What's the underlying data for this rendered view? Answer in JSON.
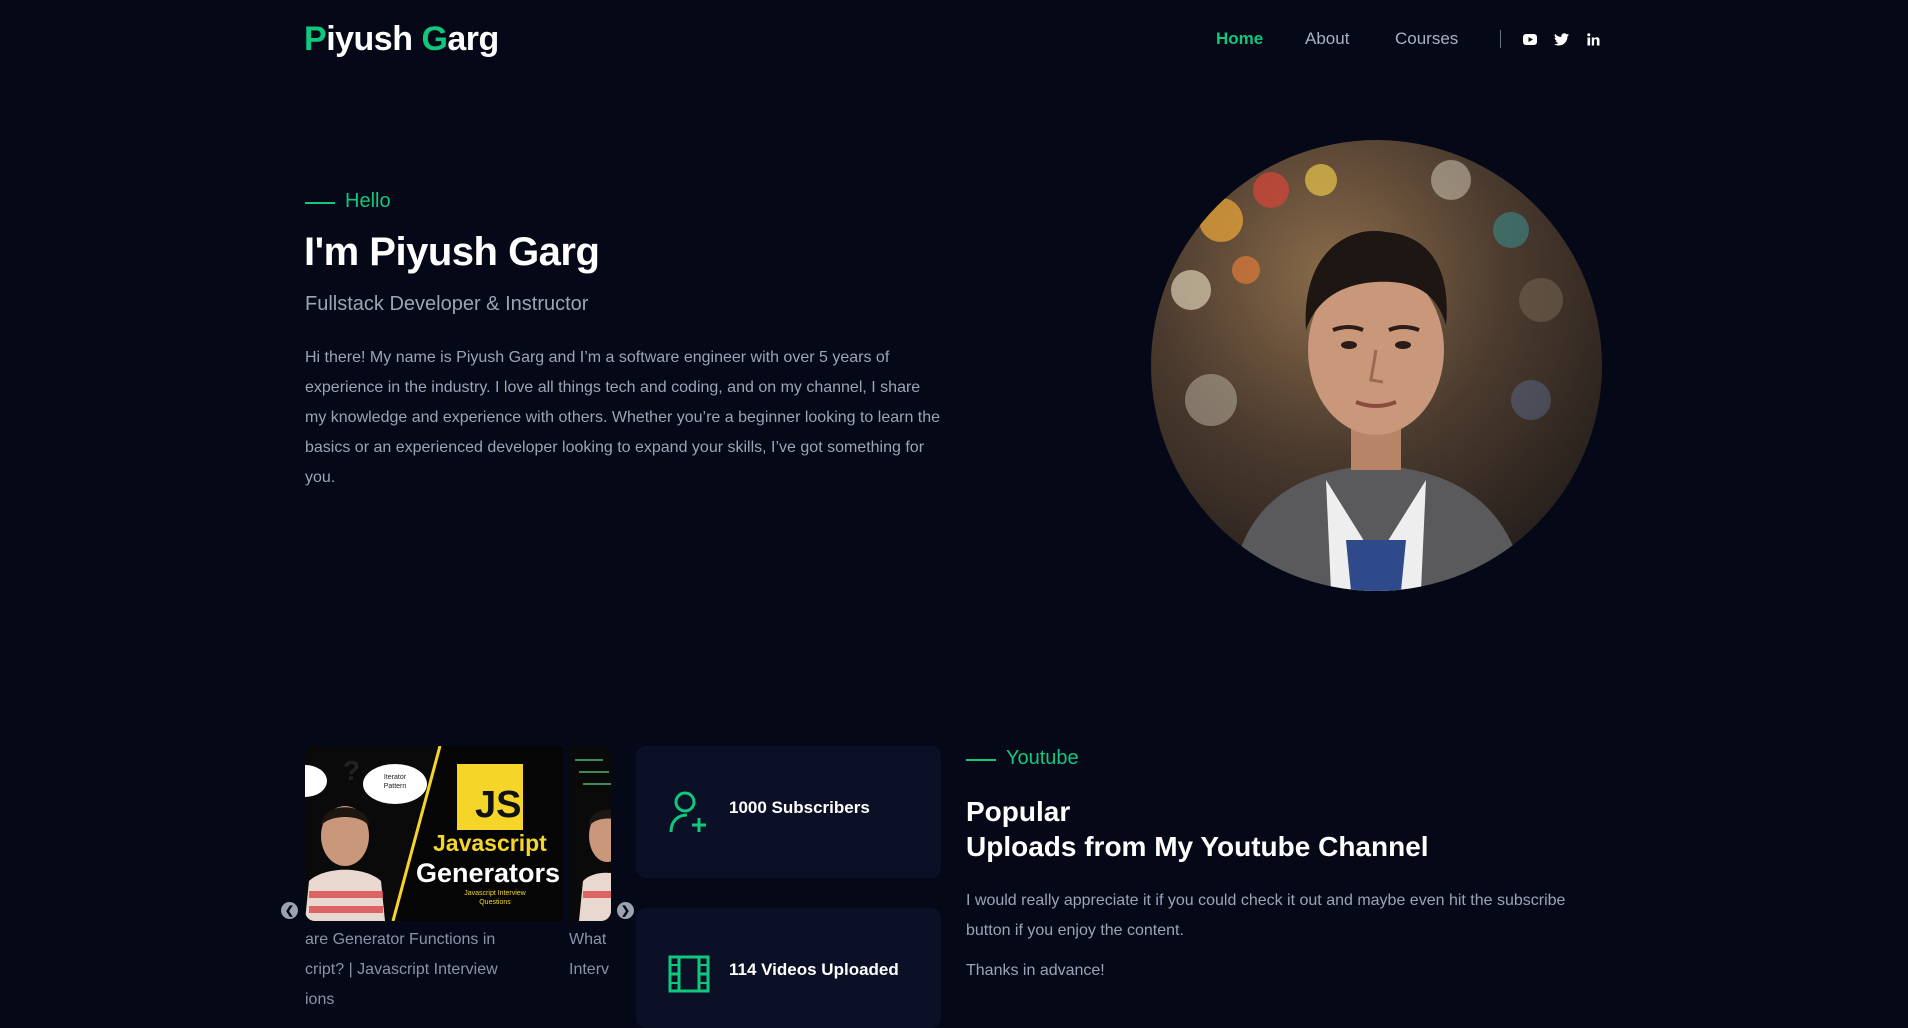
{
  "header": {
    "logo_p": "P",
    "logo_iyush": "iyush ",
    "logo_g": "G",
    "logo_arg": "arg",
    "nav": [
      {
        "label": "Home",
        "active": true
      },
      {
        "label": "About",
        "active": false
      },
      {
        "label": "Courses",
        "active": false
      }
    ],
    "socials": [
      "youtube-icon",
      "twitter-icon",
      "linkedin-icon"
    ],
    "accent_color": "#10c77e",
    "background": "#050816"
  },
  "hero": {
    "eyebrow": "Hello",
    "name": "I'm Piyush Garg",
    "role": "Fullstack Developer & Instructor",
    "bio": "Hi there! My name is Piyush Garg and I’m a software engineer with over 5 years of experience in the industry. I love all things tech and coding, and on my channel, I share my knowledge and experience with others. Whether you’re a beginner looking to learn the basics or an experienced developer looking to expand your skills, I’ve got something for you."
  },
  "carousel": {
    "thumb_badge": "JS",
    "thumb_title_1": "Javascript",
    "thumb_title_2": "Generators",
    "thumb_sub_1": "Javascript Interview",
    "thumb_sub_2": "Questions",
    "thumb_bubble_1": "Iterator",
    "thumb_bubble_2": "Pattern",
    "caption_1_line1": "are Generator Functions in",
    "caption_1_line2": "cript? | Javascript Interview",
    "caption_1_line3": "ions",
    "caption_2_line1": "What",
    "caption_2_line2": "Interv",
    "prev_icon": "chevron-left-icon",
    "next_icon": "chevron-right-icon"
  },
  "stats": [
    {
      "icon": "user-plus-icon",
      "label": "1000 Subscribers"
    },
    {
      "icon": "film-icon",
      "label": "114 Videos Uploaded"
    }
  ],
  "youtube": {
    "eyebrow": "Youtube",
    "title_line1": "Popular",
    "title_line2": "Uploads from My Youtube Channel",
    "description": "I would really appreciate it if you could check it out and maybe even hit the subscribe button if you enjoy the content.",
    "thanks": "Thanks in advance!"
  }
}
